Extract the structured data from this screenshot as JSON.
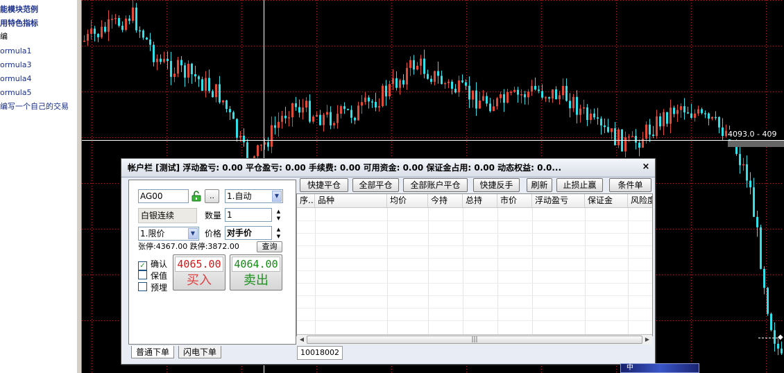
{
  "tree": {
    "items": [
      {
        "label": "能模块范例",
        "style": "bold"
      },
      {
        "label": "用特色指标",
        "style": "bold"
      },
      {
        "label": "编",
        "style": "black"
      },
      {
        "label": "ormula1",
        "style": ""
      },
      {
        "label": "ormula3",
        "style": ""
      },
      {
        "label": "ormula4",
        "style": ""
      },
      {
        "label": "ormula5",
        "style": ""
      },
      {
        "label": "编写一个自己的交易",
        "style": ""
      }
    ]
  },
  "chart": {
    "price_label": "4093.0 - 409",
    "colors": {
      "up": "#e14b3a",
      "down": "#33e0e8",
      "grid": "#c02020",
      "crosshair": "#ffffff"
    }
  },
  "dialog": {
    "title": "帐户栏 [测试]  浮动盈亏: 0.00    平仓盈亏: 0.00    手续费: 0.00    可用资金: 0.00    保证金占用: 0.00    动态权益: 0.0...",
    "close": "×",
    "order": {
      "symbol_value": "AG00",
      "symbol_btn": "..",
      "mode_select": "1.自动",
      "contract_name": "白银连续",
      "qty_label": "数量",
      "qty_value": "1",
      "price_type": "1.限价",
      "price_label": "价格",
      "price_value": "对手价",
      "limit_text": "张停:4367.00 跌停:3872.00",
      "query_btn": "查询",
      "checks": [
        {
          "label": "确认",
          "checked": true
        },
        {
          "label": "保值",
          "checked": false
        },
        {
          "label": "预埋",
          "checked": false
        }
      ],
      "buy_price": "4065.00",
      "buy_label": "买入",
      "sell_price": "4064.00",
      "sell_label": "卖出"
    },
    "tabs": [
      "普通下单",
      "闪电下单"
    ],
    "toolbar": [
      "快捷平仓",
      "全部平仓",
      "全部账户平仓",
      "快捷反手",
      "刷新",
      "止损止赢",
      "条件单"
    ],
    "columns": [
      "序...",
      "品种",
      "均价",
      "今持",
      "总持",
      "市价",
      "浮动盈亏",
      "保证金",
      "风险度"
    ],
    "scroll_grip": "|||",
    "account_tab": "10018002"
  },
  "bottom_deco": "中"
}
